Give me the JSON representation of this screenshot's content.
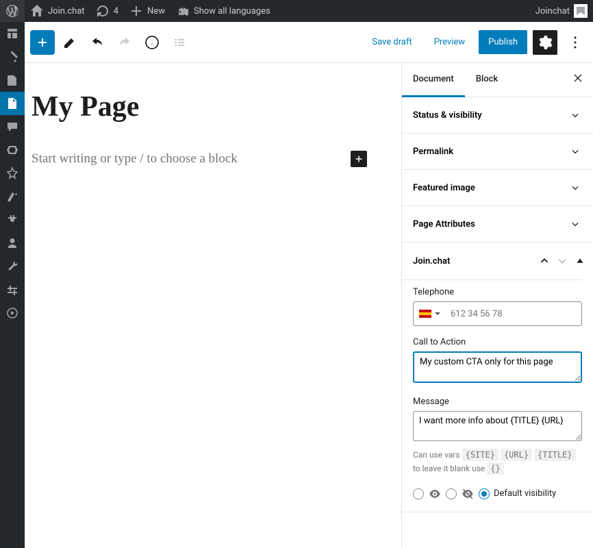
{
  "adminBar": {
    "siteName": "Join.chat",
    "updates": "4",
    "new": "New",
    "showLanguages": "Show all languages",
    "userGreeting": "Joinchat"
  },
  "header": {
    "saveDraft": "Save draft",
    "preview": "Preview",
    "publish": "Publish"
  },
  "canvas": {
    "title": "My Page",
    "placeholder": "Start writing or type / to choose a block"
  },
  "inspector": {
    "tabs": {
      "document": "Document",
      "block": "Block"
    },
    "panels": {
      "status": "Status & visibility",
      "permalink": "Permalink",
      "featuredImage": "Featured image",
      "pageAttributes": "Page Attributes",
      "joinchat": "Join.chat"
    },
    "joinchat": {
      "telephoneLabel": "Telephone",
      "phonePlaceholder": "612 34 56 78",
      "ctaLabel": "Call to Action",
      "ctaValue": "My custom CTA only for this page",
      "messageLabel": "Message",
      "messageValue": "I want more info about {TITLE} {URL}",
      "helpPrefix": "Can use vars",
      "var1": "{SITE}",
      "var2": "{URL}",
      "var3": "{TITLE}",
      "helpMiddle": "to leave it blank use",
      "var4": "{}",
      "defaultVisibility": "Default visibility"
    }
  }
}
